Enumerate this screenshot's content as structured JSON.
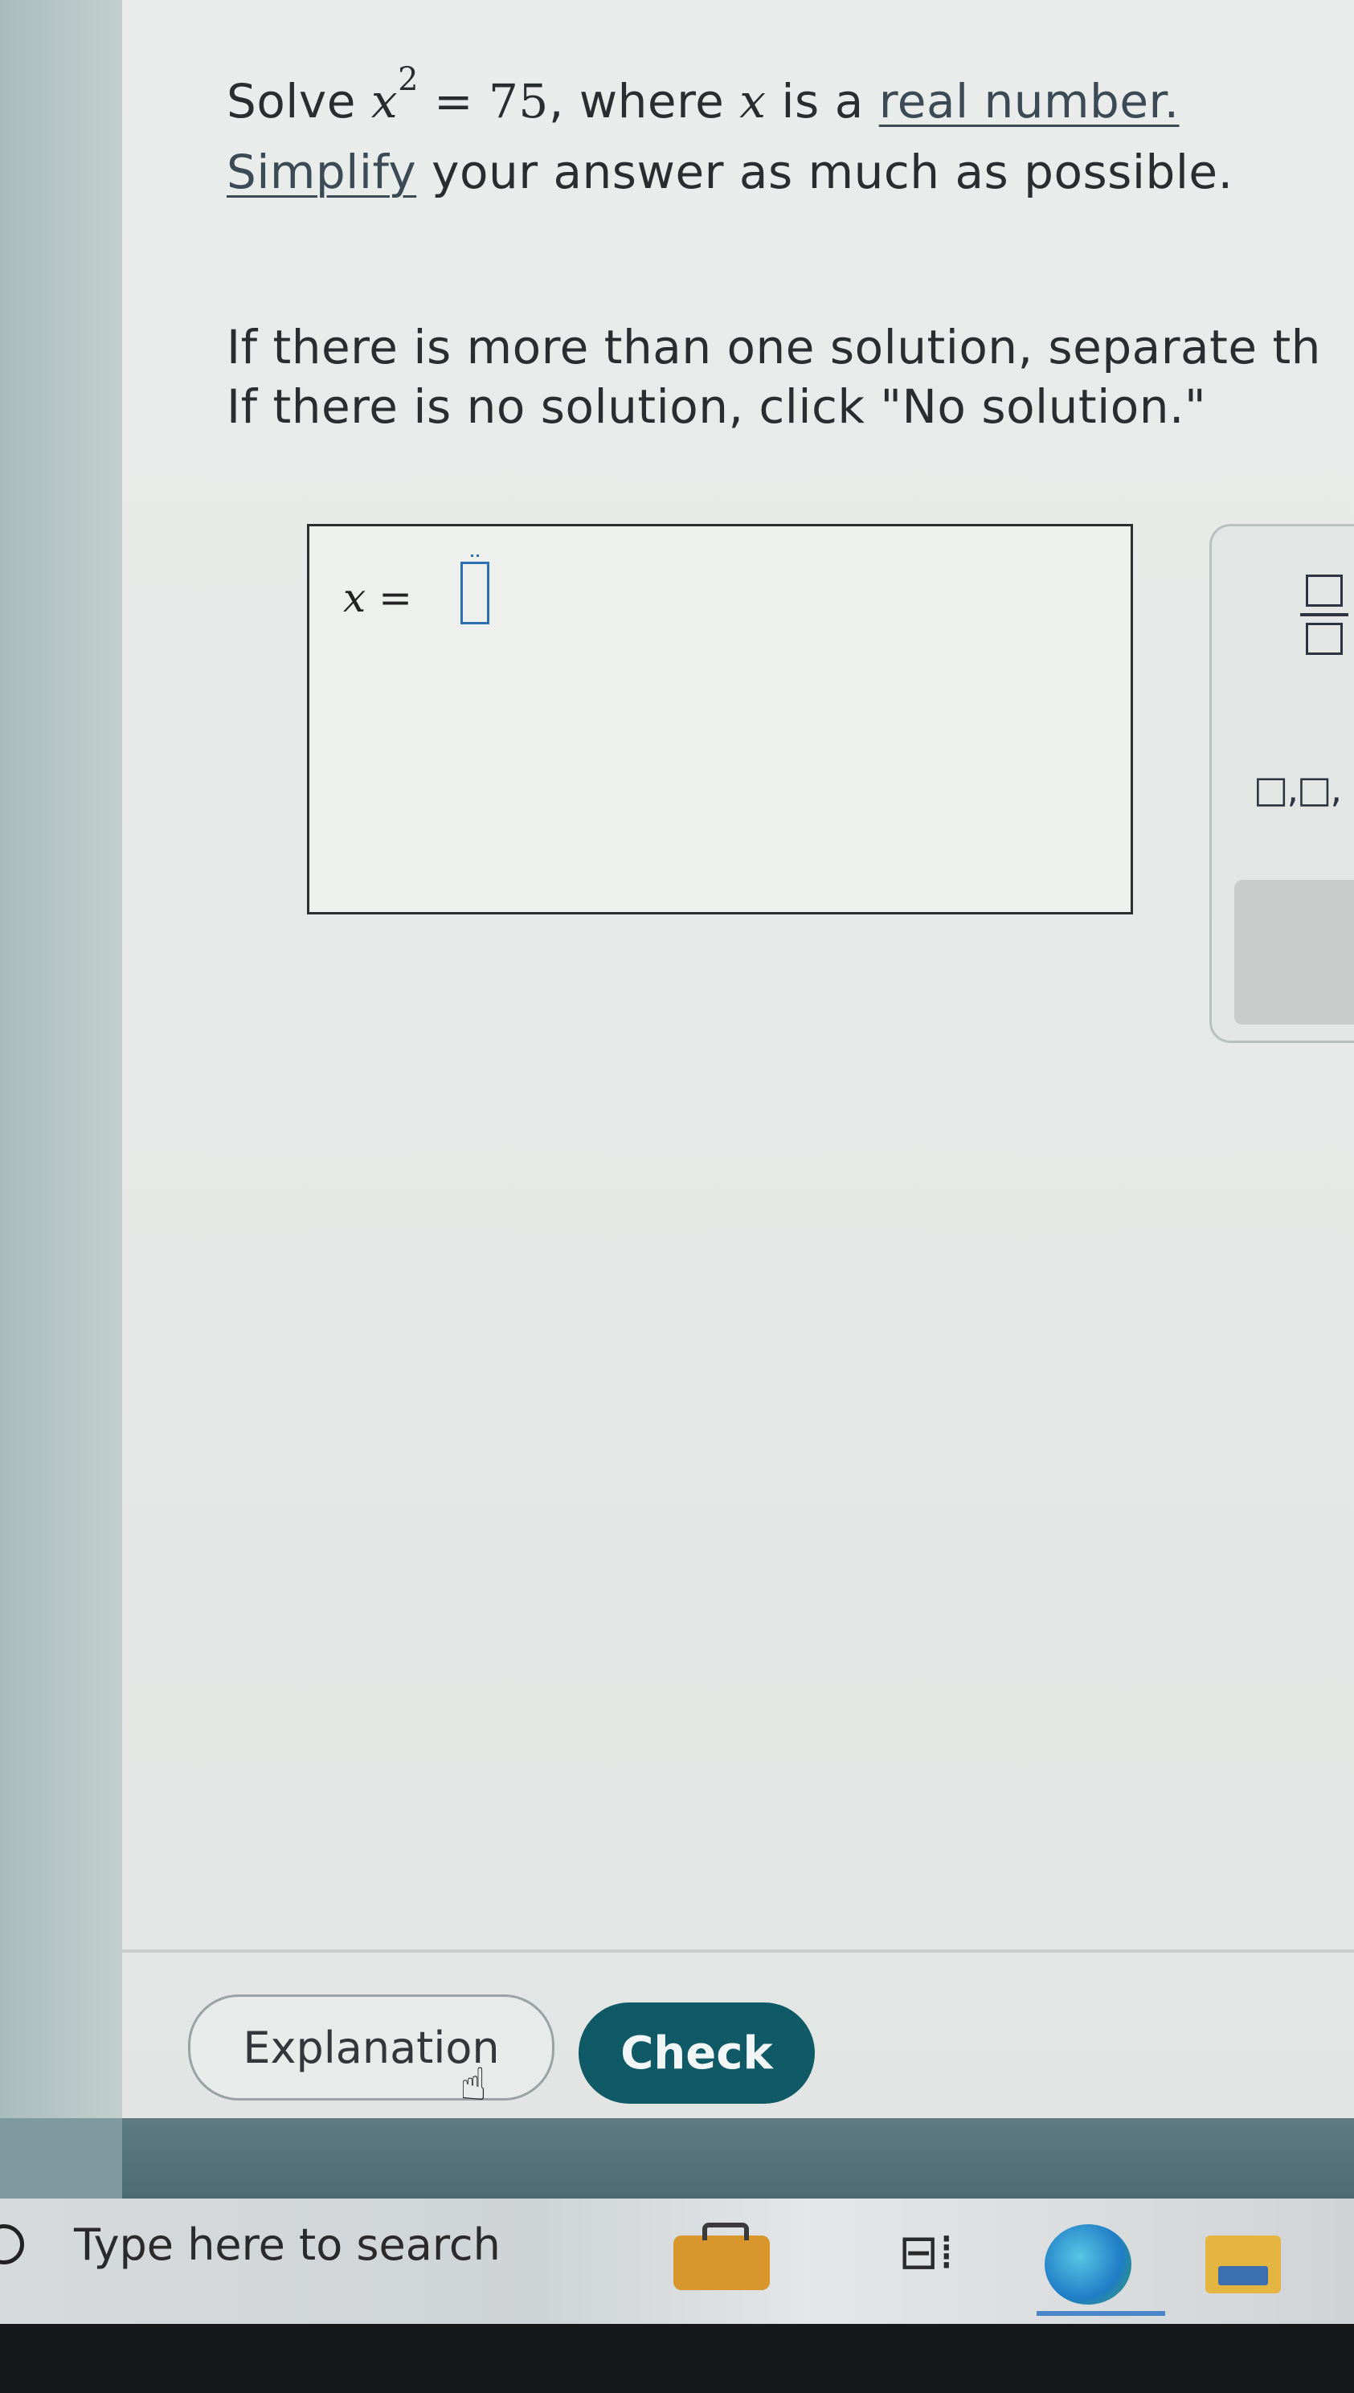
{
  "question": {
    "line1_prefix": "Solve ",
    "var_x": "x",
    "exponent": "2",
    "equals_value": " = 75",
    "line1_mid": ", where ",
    "line1_mid2": " is a ",
    "real_number_link": "real number.",
    "simplify_link": "Simplify",
    "line2_rest": " your answer as much as possible.",
    "line3": "If there is more than one solution, separate th",
    "line4": "If there is no solution, click \"No solution.\""
  },
  "answer": {
    "label": "x =",
    "value": ""
  },
  "tools": {
    "list_symbol": "□,□,"
  },
  "buttons": {
    "explanation": "Explanation",
    "check": "Check"
  },
  "taskbar": {
    "search_placeholder": "Type here to search",
    "icons": [
      "search-icon",
      "briefcase-icon",
      "task-view-icon",
      "edge-icon",
      "file-explorer-icon"
    ]
  },
  "colors": {
    "check_button": "#0f5a66",
    "input_border": "#2d6fb5"
  }
}
